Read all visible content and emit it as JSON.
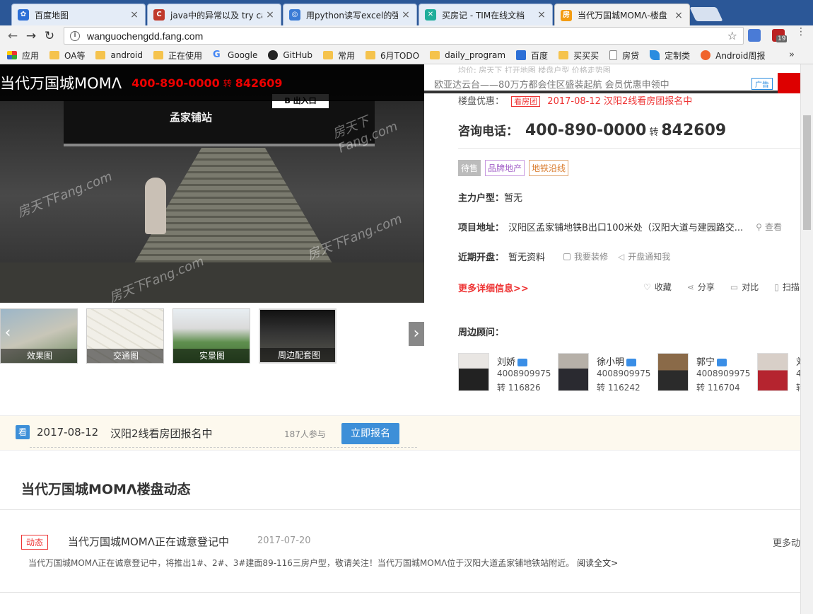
{
  "browser": {
    "tabs": [
      {
        "title": "百度地图",
        "favicon_color": "#2c6fd6",
        "favicon": "paw-icon"
      },
      {
        "title": "java中的异常以及 try ca",
        "favicon_color": "#c0392b",
        "favicon": "c-icon"
      },
      {
        "title": "用python读写excel的强",
        "favicon_color": "#3a7bd5",
        "favicon": "globe-icon"
      },
      {
        "title": "买房记 - TIM在线文档",
        "favicon_color": "#1fae9b",
        "favicon": "x-doc-icon"
      },
      {
        "title": "当代万国城MOMΛ-楼盘",
        "favicon_color": "#f39c12",
        "favicon": "fang-icon"
      }
    ],
    "url": "wanguochengdd.fang.com",
    "ext_badge": "19"
  },
  "bookmarks": [
    {
      "label": "应用",
      "icon": "apps-grid-icon"
    },
    {
      "label": "OA等",
      "icon": "folder-icon"
    },
    {
      "label": "android",
      "icon": "folder-icon"
    },
    {
      "label": "正在使用",
      "icon": "folder-icon"
    },
    {
      "label": "Google",
      "icon": "google-icon"
    },
    {
      "label": "GitHub",
      "icon": "github-icon"
    },
    {
      "label": "常用",
      "icon": "folder-icon"
    },
    {
      "label": "6月TODO",
      "icon": "folder-icon"
    },
    {
      "label": "daily_program",
      "icon": "folder-icon"
    },
    {
      "label": "百度",
      "icon": "baidu-icon"
    },
    {
      "label": "买买买",
      "icon": "folder-icon"
    },
    {
      "label": "房贷",
      "icon": "doc-icon"
    },
    {
      "label": "定制类",
      "icon": "rocket-icon"
    },
    {
      "label": "Android周报",
      "icon": "orange-circle-icon"
    }
  ],
  "bookmarks_more": "»",
  "page": {
    "banner": {
      "name": "当代万国城MOMΛ",
      "tel": "400-890-0000",
      "zhuan": "转",
      "ext": "842609"
    },
    "ad": {
      "text": "欧亚达云台——80万方都会住区盛装起航 会员优惠申领中",
      "label": "广告"
    },
    "hidden_row": "均价:  房天下  打开地图  楼盘户型  价格走势图",
    "promo": {
      "label": "楼盘优惠：",
      "tag": "看房团",
      "text": "2017-08-12  汉阳2线看房团报名中"
    },
    "consult": {
      "label": "咨询电话：",
      "number": "400-890-0000",
      "zhuan": "转",
      "ext": "842609"
    },
    "tags": [
      {
        "text": "待售",
        "color": "#ffffff",
        "bg": "#bbbbbb",
        "border": "#bbbbbb"
      },
      {
        "text": "品牌地产",
        "color": "#a463c9",
        "bg": "#ffffff",
        "border": "#c89ae0"
      },
      {
        "text": "地铁沿线",
        "color": "#d97b2b",
        "bg": "#ffffff",
        "border": "#e0a672"
      }
    ],
    "main_type": {
      "label": "主力户型：",
      "value": "暂无"
    },
    "address": {
      "label": "项目地址：",
      "value": "汉阳区孟家铺地铁B出口100米处（汉阳大道与建园路交...",
      "map": "查看"
    },
    "opening": {
      "label": "近期开盘：",
      "value": "暂无资料",
      "decorate": "我要装修",
      "notify": "开盘通知我"
    },
    "more_info": "更多详细信息>>",
    "actions": {
      "favorite": "收藏",
      "share": "分享",
      "compare": "对比",
      "scan": "扫描"
    },
    "photo_texts": {
      "station": "孟家铺站",
      "exit": "B 出入口",
      "watermark": "房天下Fang.com"
    },
    "thumbnails": [
      {
        "caption": "效果图",
        "icon": "rendering-image"
      },
      {
        "caption": "交通图",
        "icon": "map-image"
      },
      {
        "caption": "实景图",
        "icon": "model-image"
      },
      {
        "caption": "周边配套图",
        "icon": "station-image"
      }
    ],
    "advisors_label": "周边顾问：",
    "advisors": [
      {
        "name": "刘娇",
        "phone": "4008909975",
        "ext": "转 116826"
      },
      {
        "name": "徐小明",
        "phone": "4008909975",
        "ext": "转 116242"
      },
      {
        "name": "郭宁",
        "phone": "4008909975",
        "ext": "转 116704"
      },
      {
        "name": "刘",
        "phone": "4",
        "ext": "转"
      }
    ],
    "group": {
      "icon": "看",
      "date": "2017-08-12",
      "title": "汉阳2线看房团报名中",
      "count": "187人参与",
      "button": "立即报名"
    },
    "dynamics": {
      "title": "当代万国城MOMΛ楼盘动态",
      "badge": "动态",
      "headline": "当代万国城MOMΛ正在诚意登记中",
      "date": "2017-07-20",
      "more": "更多动",
      "body": "当代万国城MOMΛ正在诚意登记中，将推出1#、2#、3#建面89-116三房户型，敬请关注！当代万国城MOMΛ位于汉阳大道孟家铺地铁站附近。",
      "read": "阅读全文>"
    }
  }
}
